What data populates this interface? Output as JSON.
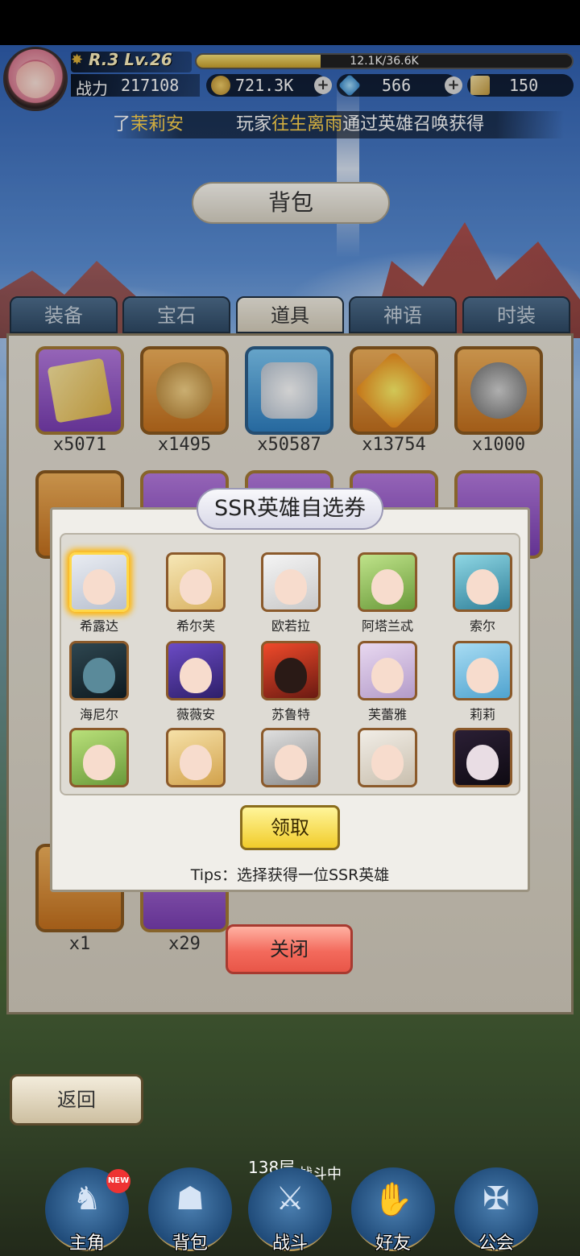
{
  "player": {
    "rank_level": "R.3 Lv.26",
    "exp_text": "12.1K/36.6K",
    "exp_fraction": 0.33,
    "power_label": "战力",
    "power_value": "217108",
    "gold": "721.3K",
    "diamond": "566",
    "tickets": "150"
  },
  "ticker": {
    "part1": "了",
    "name1": "茉莉安",
    "part2": "玩家",
    "name2": "往生离雨",
    "part3": "通过英雄召唤获得"
  },
  "title": "背包",
  "tabs": [
    "装备",
    "宝石",
    "道具",
    "神语",
    "时装"
  ],
  "active_tab": 2,
  "inventory_counts": {
    "row1": [
      "x5071",
      "x1495",
      "x50587",
      "x13754",
      "x1000"
    ],
    "row_bottom": [
      "x1",
      "x29"
    ]
  },
  "modal": {
    "title": "SSR英雄自选券",
    "heroes": [
      "希露达",
      "希尔芙",
      "欧若拉",
      "阿塔兰忒",
      "索尔",
      "海尼尔",
      "薇薇安",
      "苏鲁特",
      "芙蕾雅",
      "莉莉"
    ],
    "claim_label": "领取",
    "tips": "Tips：选择获得一位SSR英雄",
    "selected_index": 0
  },
  "close_label": "关闭",
  "back_label": "返回",
  "floor_text": "138层",
  "fighting_text": "战斗中",
  "nav": [
    "主角",
    "背包",
    "战斗",
    "好友",
    "公会"
  ],
  "new_badge": "NEW",
  "colors": {
    "ticker_highlight": "#ffd34d",
    "tab_active": "#f3efe4",
    "claim_button": "#f1cc2a",
    "close_button": "#f36a5c"
  }
}
